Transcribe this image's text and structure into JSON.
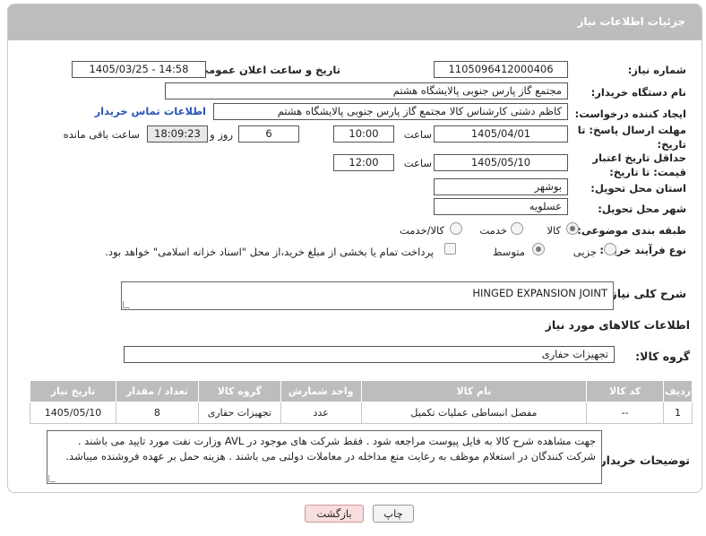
{
  "header": {
    "title": "جزئیات اطلاعات نیاز"
  },
  "need_number": {
    "label": "شماره نیاز:",
    "value": "1105096412000406"
  },
  "announce": {
    "label": "تاریخ و ساعت اعلان عمومی:",
    "value": "1405/03/25 - 14:58"
  },
  "buyer": {
    "label": "نام دستگاه خریدار:",
    "value": "مجتمع گاز پارس جنوبی  پالایشگاه هشتم"
  },
  "creator": {
    "label": "ایجاد کننده درخواست:",
    "value": "کاظم دشتی کارشناس کالا مجتمع گاز پارس جنوبی  پالایشگاه هشتم",
    "contact_link": "اطلاعات تماس خریدار"
  },
  "deadline": {
    "label": "مهلت ارسال پاسخ: تا تاریخ:",
    "date": "1405/04/01",
    "time_label": "ساعت",
    "time": "10:00",
    "days": "6",
    "days_label": "روز و",
    "remaining": "18:09:23",
    "remaining_label": "ساعت باقی مانده"
  },
  "price_validity": {
    "label": "حداقل تاریخ اعتبار قیمت: تا تاریخ:",
    "date": "1405/05/10",
    "time_label": "ساعت",
    "time": "12:00"
  },
  "province": {
    "label": "استان محل تحویل:",
    "value": "بوشهر"
  },
  "city": {
    "label": "شهر محل تحویل:",
    "value": "عسلویه"
  },
  "category": {
    "label": "طبقه بندی موضوعی:",
    "options": [
      "کالا",
      "خدمت",
      "کالا/خدمت"
    ],
    "selected": "کالا"
  },
  "process": {
    "label": "نوع فرآیند خرید :",
    "options": [
      "جزیی",
      "متوسط"
    ],
    "selected": "متوسط",
    "payment_note": "پرداخت تمام یا بخشی از مبلغ خرید،از محل \"اسناد خزانه اسلامی\" خواهد بود."
  },
  "description": {
    "label": "شرح کلی نیاز:",
    "value": "HINGED EXPANSION JOINT"
  },
  "goods_info": {
    "title": "اطلاعات کالاهای مورد نیاز"
  },
  "goods_group": {
    "label": "گروه کالا:",
    "value": "تجهیزات حفاری"
  },
  "table": {
    "headers": [
      "ردیف",
      "کد کالا",
      "نام کالا",
      "واحد شمارش",
      "گروه کالا",
      "تعداد / مقدار",
      "تاریخ نیاز"
    ],
    "rows": [
      [
        "1",
        "--",
        "مفصل انبساطی عملیات تکمیل",
        "عدد",
        "تجهیزات حفاری",
        "8",
        "1405/05/10"
      ]
    ]
  },
  "buyer_notes": {
    "label": "توضیحات خریدار:",
    "value": "جهت مشاهده شرح کالا به فایل پیوست مراجعه شود . فقط شرکت های موجود در AVL وزارت نفت مورد تایید می باشند . شرکت کنندگان در استعلام موظف به رعایت منع مداخله در معاملات دولتی می باشند . هزینه حمل بر عهده فروشنده میباشد."
  },
  "buttons": {
    "print": "چاپ",
    "back": "بازگشت"
  },
  "watermark": {
    "text": "AriaTender.net"
  },
  "colors": {
    "header_bg": "#bdbdbd",
    "link": "#2a55b8",
    "watermark": "#e9c9c9"
  }
}
